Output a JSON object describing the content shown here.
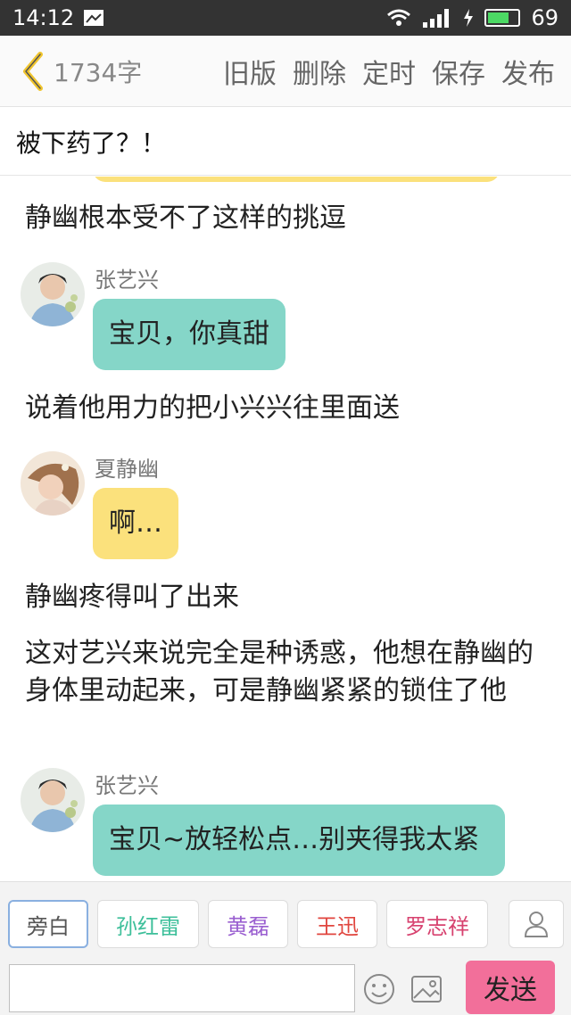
{
  "status": {
    "time": "14:12",
    "battery": "69",
    "battery_level": 0.69
  },
  "header": {
    "word_count": "1734字",
    "actions": [
      "旧版",
      "删除",
      "定时",
      "保存",
      "发布"
    ]
  },
  "chapter_title": "被下药了？！",
  "story": {
    "narration": [
      "静幽根本受不了这样的挑逗",
      "说着他用力的把小兴兴往里面送",
      "静幽疼得叫了出来",
      "这对艺兴来说完全是种诱惑，他想在静幽的身体里动起来，可是静幽紧紧的锁住了他"
    ],
    "messages": [
      {
        "speaker": "张艺兴",
        "text": "宝贝，你真甜"
      },
      {
        "speaker": "夏静幽",
        "text": "啊…"
      },
      {
        "speaker": "张艺兴",
        "text": "宝贝~放轻松点…别夹得我太紧"
      }
    ]
  },
  "characters": [
    "旁白",
    "孙红雷",
    "黄磊",
    "王迅",
    "罗志祥"
  ],
  "colors": {
    "chip_text": [
      "#555555",
      "#3dbf9a",
      "#9a5fd0",
      "#e0463f",
      "#d7426f"
    ],
    "bubble_teal": "#85d6c8",
    "bubble_yellow": "#fbe17c",
    "send_button": "#f26f9a"
  },
  "composer": {
    "input_value": "",
    "send_label": "发送"
  },
  "icons": [
    "back-chevron-icon",
    "wifi-icon",
    "signal-icon",
    "battery-icon",
    "add-user-icon",
    "emoji-icon",
    "image-icon"
  ]
}
